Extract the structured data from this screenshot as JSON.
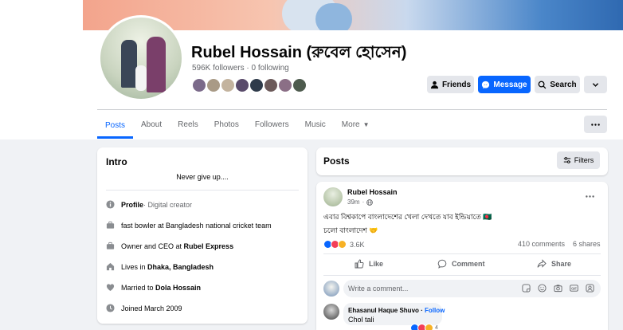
{
  "profile": {
    "name": "Rubel Hossain (রুবেল হোসেন)",
    "followers": "596K followers",
    "following": "0 following",
    "friend_avatar_colors": [
      "#7b6a8a",
      "#a99a86",
      "#c3b39e",
      "#5a4b6b",
      "#2f3b4a",
      "#6c5a5a",
      "#8b6f86",
      "#4e5b4e"
    ]
  },
  "actions": {
    "friends": "Friends",
    "message": "Message",
    "search": "Search"
  },
  "tabs": [
    "Posts",
    "About",
    "Reels",
    "Photos",
    "Followers",
    "Music",
    "More"
  ],
  "intro": {
    "title": "Intro",
    "bio": "Never give up....",
    "rows": [
      {
        "bold": "Profile",
        "text": " · Digital creator",
        "icon": "info-icon"
      },
      {
        "bold": "",
        "text": "fast bowler at Bangladesh national cricket team",
        "icon": "briefcase-icon"
      },
      {
        "prefix": "Owner and CEO at ",
        "bold": "Rubel Express",
        "icon": "briefcase-icon"
      },
      {
        "prefix": "Lives in ",
        "bold": "Dhaka, Bangladesh",
        "icon": "home-icon"
      },
      {
        "prefix": "Married to ",
        "bold": "Dola Hossain",
        "icon": "heart-icon"
      },
      {
        "prefix": "Joined March 2009",
        "bold": "",
        "icon": "clock-icon"
      }
    ]
  },
  "posts_header": {
    "title": "Posts",
    "filters": "Filters"
  },
  "post": {
    "author": "Rubel Hossain",
    "time": "39m",
    "text_line1": "এবার বিশ্বকাপে বাংলাদেশের খেলা দেখতে যাব ইন্ডিয়াতে 🇧🇩",
    "text_line2": "চলো বাংলাদেশ 🤝",
    "reaction_count": "3.6K",
    "comments": "410 comments",
    "shares": "6 shares",
    "like": "Like",
    "comment": "Comment",
    "share": "Share",
    "comment_placeholder": "Write a comment..."
  },
  "comment": {
    "author": "Ehasanul Haque Shuvo",
    "follow": "Follow",
    "text": "Chol tali",
    "reaction_count": "4"
  },
  "colors": {
    "accent": "#0866ff",
    "background": "#f0f2f5",
    "secondary_text": "#65676b"
  }
}
